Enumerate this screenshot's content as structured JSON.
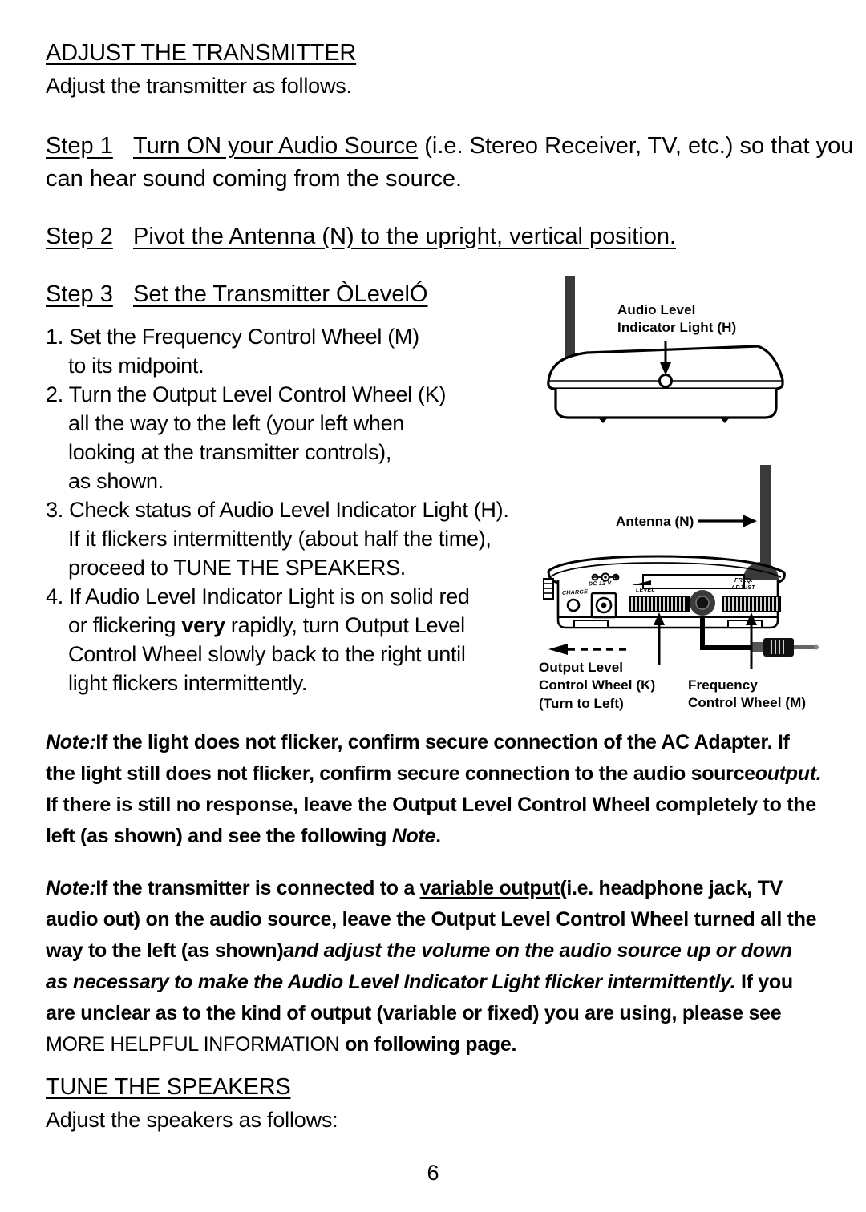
{
  "document": {
    "page_number": "6"
  },
  "section1": {
    "heading": "ADJUST THE TRANSMITTER",
    "intro": "Adjust the transmitter as follows."
  },
  "steps": {
    "step1": {
      "label": "Step 1",
      "underlined_part": "Turn ON your Audio Source",
      "rest": " (i.e. Stereo Receiver, TV, etc.) so that you",
      "line2": "can hear sound coming from the source."
    },
    "step2": {
      "label": "Step 2",
      "text": "Pivot the Antenna (N) to the upright, vertical position."
    },
    "step3": {
      "label": "Step 3",
      "text": "Set the Transmitter ÒLevelÓ"
    }
  },
  "numbered_list": [
    {
      "num": "1.",
      "lines": [
        "Set the Frequency Control Wheel (M)",
        "to its midpoint."
      ]
    },
    {
      "num": "2.",
      "lines": [
        "Turn the Output Level Control Wheel (K)",
        "all the way to the left (your left when",
        "looking at the transmitter controls),",
        "as shown."
      ]
    },
    {
      "num": "3.",
      "lines": [
        "Check status of Audio Level Indicator Light (H).",
        "If it flickers intermittently (about half the time),",
        "proceed to TUNE THE SPEAKERS."
      ]
    },
    {
      "num": "4.",
      "lines": [
        "If Audio Level Indicator Light is on solid red",
        "or flickering very rapidly, turn Output Level",
        "Control Wheel slowly back to the right until",
        "light flickers intermittently."
      ],
      "bold_word": "very"
    }
  ],
  "list_lines": {
    "l1a": "1. Set the Frequency Control Wheel (M)",
    "l1b": "to its midpoint.",
    "l2a": "2. Turn the Output Level Control Wheel (K)",
    "l2b": "all the way to the left (your left when",
    "l2c": "looking at the transmitter controls),",
    "l2d": "as shown.",
    "l3a": "3. Check status of Audio Level Indicator Light (H).",
    "l3b": "If it flickers intermittently (about half the time),",
    "l3c": "proceed to TUNE THE SPEAKERS.",
    "l4a": "4. If Audio Level Indicator Light is on solid red",
    "l4b_pre": "or flickering ",
    "l4b_bold": "very",
    "l4b_post": " rapidly, turn Output Level",
    "l4c": "Control Wheel slowly back to the right until",
    "l4d": "light flickers intermittently."
  },
  "note1": {
    "label": "Note:",
    "l1": "If the light does not flicker, confirm secure connection of the AC Adapter. If",
    "l2_pre": "the light still does not flicker, confirm secure connection to the audio source",
    "l2_italic": "output.",
    "l3": "If there is still no response, leave the Output Level Control Wheel completely to the",
    "l4_pre": "left (as shown) and see the following ",
    "l4_italic": "Note",
    "l4_post": "."
  },
  "note2": {
    "label": "Note:",
    "l1_pre": "If the transmitter is connected to a ",
    "l1_underline": "variable output",
    "l1_post": "(i.e. headphone jack, TV",
    "l2": "audio out) on the audio source, leave the Output Level Control Wheel turned all the",
    "l3_pre": "way to the left (as shown)",
    "l3_italic": "and adjust the volume on the audio source up or down",
    "l4_italic": "as necessary to make the Audio Level Indicator Light flicker intermittently.",
    "l4_post": " If you",
    "l5": "are unclear as to the kind of output (variable or fixed) you are using, please see",
    "l6_reg": "MORE HELPFUL INFORMATION",
    "l6_bold": " on following page."
  },
  "section2": {
    "heading": "TUNE THE SPEAKERS",
    "intro": "Adjust the speakers as follows:"
  },
  "figure_top": {
    "callout_line1": "Audio Level",
    "callout_line2": "Indicator Light (H)",
    "icon_arrow": "down-arrow-icon",
    "indicator_light": "indicator-light-icon"
  },
  "figure_bottom": {
    "antenna_label": "Antenna (N)",
    "output_label_line1": "Output Level",
    "output_label_line2": "Control Wheel (K)",
    "output_label_line3": "(Turn to Left)",
    "frequency_label_line1": "Frequency",
    "frequency_label_line2": "Control Wheel (M)",
    "panel": {
      "charge": "CHARGE",
      "dc": "DC 12 V",
      "level": "LEVEL",
      "freq_line1": "FREQ.",
      "freq_line2": "ADJUST"
    }
  },
  "colors": {
    "ink": "#000000",
    "paper": "#ffffff",
    "antenna": "#3a3a3a"
  }
}
